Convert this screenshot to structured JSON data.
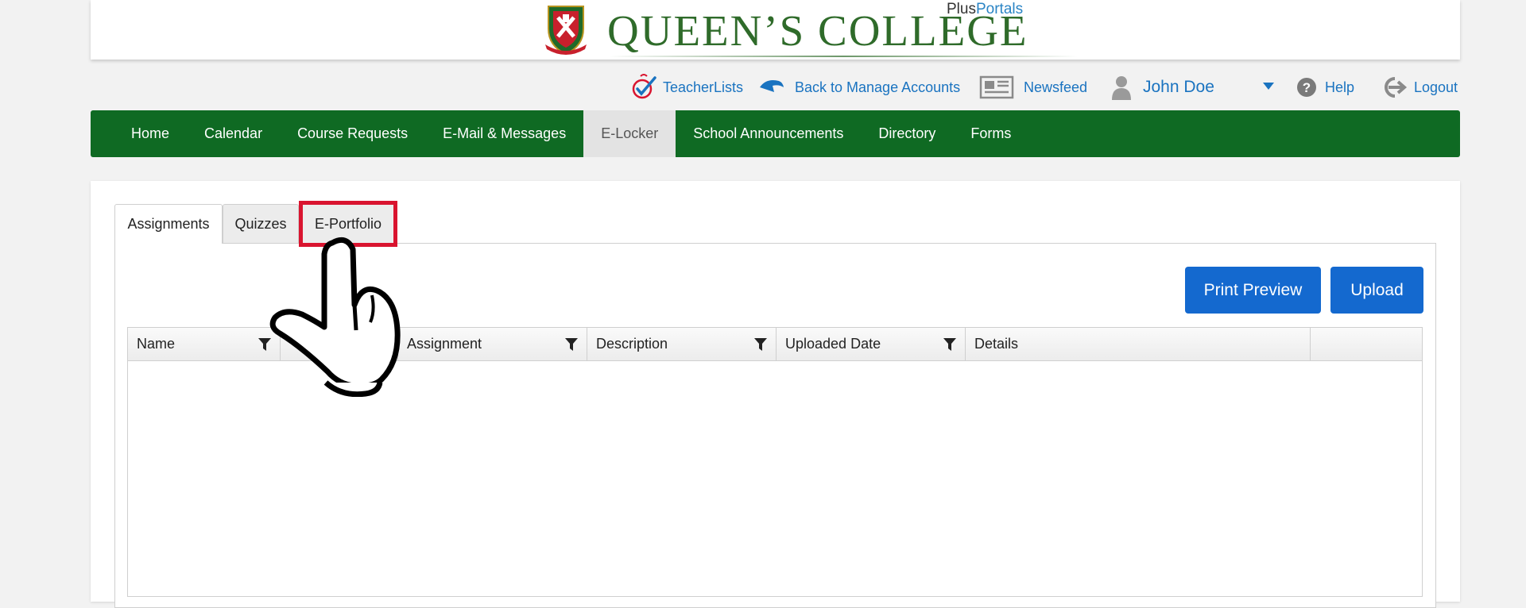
{
  "header": {
    "school_name": "QUEEN’S COLLEGE",
    "brand_plus": "Plus",
    "brand_portals": "Portals",
    "crest_icon": "school-crest-icon"
  },
  "utility": {
    "teacherlists": "TeacherLists",
    "back_to_manage": "Back to Manage Accounts",
    "newsfeed": "Newsfeed",
    "user_name": "John Doe",
    "help": "Help",
    "logout": "Logout"
  },
  "nav": {
    "items": [
      {
        "label": "Home"
      },
      {
        "label": "Calendar"
      },
      {
        "label": "Course Requests"
      },
      {
        "label": "E-Mail & Messages"
      },
      {
        "label": "E-Locker",
        "active": true
      },
      {
        "label": "School Announcements"
      },
      {
        "label": "Directory"
      },
      {
        "label": "Forms"
      }
    ]
  },
  "tabs": [
    {
      "label": "Assignments",
      "active": true
    },
    {
      "label": "Quizzes"
    },
    {
      "label": "E-Portfolio",
      "highlighted": true
    }
  ],
  "actions": {
    "print_preview": "Print Preview",
    "upload": "Upload"
  },
  "grid": {
    "columns": [
      {
        "label": "Name",
        "filter": true
      },
      {
        "label": "",
        "filter": false
      },
      {
        "label": "Assignment",
        "filter": true
      },
      {
        "label": "Description",
        "filter": true
      },
      {
        "label": "Uploaded Date",
        "filter": true
      },
      {
        "label": "Details",
        "filter": false
      },
      {
        "label": "",
        "filter": false
      }
    ],
    "rows": []
  },
  "colors": {
    "nav_green": "#0f6a23",
    "link_blue": "#1a73c0",
    "button_blue": "#1469cf",
    "highlight_red": "#d9142f",
    "school_green": "#2f6b2a"
  }
}
